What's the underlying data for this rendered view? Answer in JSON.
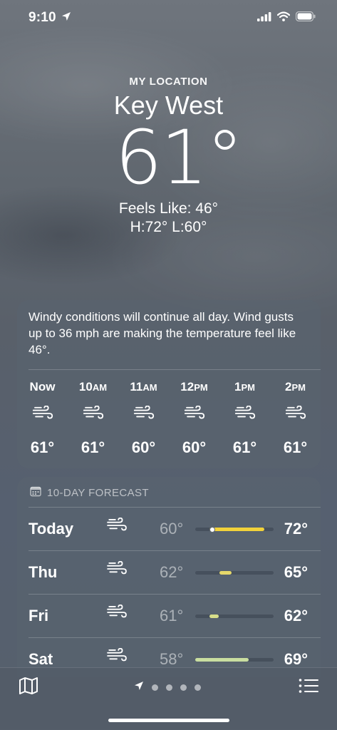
{
  "status": {
    "time": "9:10"
  },
  "location": {
    "label": "MY LOCATION",
    "city": "Key West",
    "temp": "61°",
    "feels_like": "Feels Like: 46°",
    "hi_lo": "H:72°  L:60°"
  },
  "hourly": {
    "summary": "Windy conditions will continue all day. Wind gusts up to 36 mph are making the temperature feel like 46°.",
    "hours": [
      {
        "time": "Now",
        "suffix": "",
        "temp": "61°",
        "icon": "wind-icon"
      },
      {
        "time": "10",
        "suffix": "AM",
        "temp": "61°",
        "icon": "wind-icon"
      },
      {
        "time": "11",
        "suffix": "AM",
        "temp": "60°",
        "icon": "wind-icon"
      },
      {
        "time": "12",
        "suffix": "PM",
        "temp": "60°",
        "icon": "wind-icon"
      },
      {
        "time": "1",
        "suffix": "PM",
        "temp": "61°",
        "icon": "wind-icon"
      },
      {
        "time": "2",
        "suffix": "PM",
        "temp": "61°",
        "icon": "wind-icon"
      }
    ]
  },
  "daily": {
    "title": "10-DAY FORECAST",
    "days": [
      {
        "day": "Today",
        "low": "60°",
        "high": "72°",
        "icon": "wind-icon",
        "bar_start": 0.18,
        "bar_end": 0.88,
        "color": "#f2d23a",
        "current_marker": 0.22
      },
      {
        "day": "Thu",
        "low": "62°",
        "high": "65°",
        "icon": "wind-icon",
        "bar_start": 0.31,
        "bar_end": 0.46,
        "color": "#e6d86a"
      },
      {
        "day": "Fri",
        "low": "61°",
        "high": "62°",
        "icon": "wind-icon",
        "bar_start": 0.18,
        "bar_end": 0.3,
        "color": "#d7de8a"
      },
      {
        "day": "Sat",
        "low": "58°",
        "high": "69°",
        "icon": "wind-icon",
        "bar_start": 0.0,
        "bar_end": 0.68,
        "color": "#c9dea0"
      }
    ]
  },
  "pager": {
    "pages": 4,
    "current": 0
  }
}
